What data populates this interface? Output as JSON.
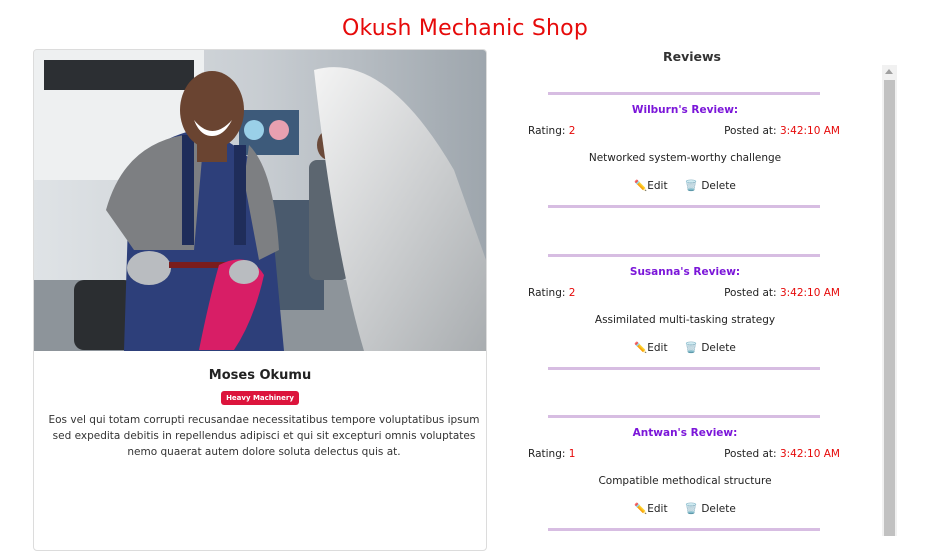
{
  "page": {
    "title": "Okush Mechanic Shop"
  },
  "mechanic": {
    "name": "Moses Okumu",
    "badge": "Heavy Machinery",
    "bio": "Eos vel qui totam corrupti recusandae necessitatibus tempore voluptatibus ipsum sed expedita debitis in repellendus adipisci et qui sit excepturi omnis voluptates nemo quaerat autem dolore soluta delectus quis at."
  },
  "reviews_section": {
    "title": "Reviews"
  },
  "reviews": [
    {
      "heading": "Wilburn's Review:",
      "rating_label": "Rating:",
      "rating": "2",
      "posted_label": "Posted at:",
      "time": "3:42:10 AM",
      "text": "Networked system-worthy challenge",
      "edit_label": "Edit",
      "delete_label": "Delete"
    },
    {
      "heading": "Susanna's Review:",
      "rating_label": "Rating:",
      "rating": "2",
      "posted_label": "Posted at:",
      "time": "3:42:10 AM",
      "text": "Assimilated multi-tasking strategy",
      "edit_label": "Edit",
      "delete_label": "Delete"
    },
    {
      "heading": "Antwan's Review:",
      "rating_label": "Rating:",
      "rating": "1",
      "posted_label": "Posted at:",
      "time": "3:42:10 AM",
      "text": "Compatible methodical structure",
      "edit_label": "Edit",
      "delete_label": "Delete"
    }
  ],
  "icons": {
    "edit": "pencil-icon",
    "delete": "wastebasket-icon"
  },
  "colors": {
    "title": "#e60a0a",
    "reviewer": "#7b16d9",
    "badge": "#dc143c",
    "divider": "#d7bde2"
  }
}
